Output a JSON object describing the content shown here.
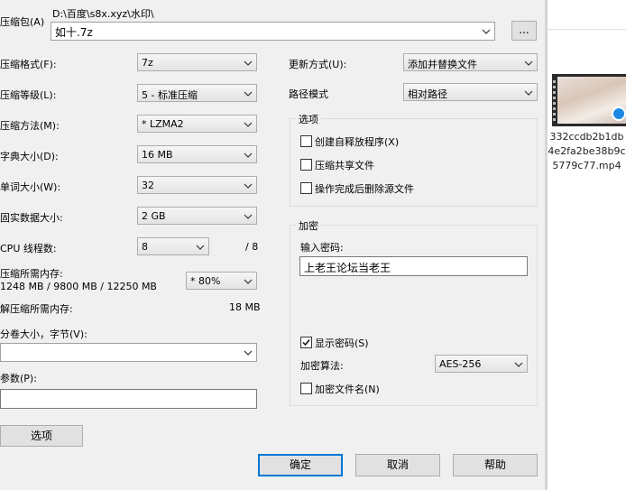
{
  "archive": {
    "label": "压缩包(A)",
    "path": "D:\\百度\\s8x.xyz\\水印\\",
    "filename": "如十.7z",
    "browse_label": "..."
  },
  "left": {
    "format": {
      "label": "压缩格式(F):",
      "value": "7z"
    },
    "level": {
      "label": "压缩等级(L):",
      "value": "5 - 标准压缩"
    },
    "method": {
      "label": "压缩方法(M):",
      "value": "* LZMA2"
    },
    "dict": {
      "label": "字典大小(D):",
      "value": "16 MB"
    },
    "word": {
      "label": "单词大小(W):",
      "value": "32"
    },
    "solid": {
      "label": "固实数据大小:",
      "value": "2 GB"
    },
    "threads": {
      "label": "CPU 线程数:",
      "value": "8",
      "total": "/ 8"
    },
    "mem_compress": {
      "label": "压缩所需内存:",
      "values": "1248 MB / 9800 MB / 12250 MB",
      "percent": "* 80%"
    },
    "mem_decompress": {
      "label": "解压缩所需内存:",
      "value": "18 MB"
    },
    "volume": {
      "label": "分卷大小，字节(V):",
      "value": ""
    },
    "params": {
      "label": "参数(P):",
      "value": ""
    },
    "options_button": "选项"
  },
  "right": {
    "update": {
      "label": "更新方式(U):",
      "value": "添加并替换文件"
    },
    "path_mode": {
      "label": "路径模式",
      "value": "相对路径"
    },
    "options_group": {
      "title": "选项",
      "sfx": {
        "label": "创建自释放程序(X)",
        "checked": false
      },
      "shared": {
        "label": "压缩共享文件",
        "checked": false
      },
      "delete": {
        "label": "操作完成后删除源文件",
        "checked": false
      }
    },
    "encryption": {
      "title": "加密",
      "password_label": "输入密码:",
      "password_value": "上老王论坛当老王",
      "show_password": {
        "label": "显示密码(S)",
        "checked": true
      },
      "method_label": "加密算法:",
      "method_value": "AES-256",
      "encrypt_names": {
        "label": "加密文件名(N)",
        "checked": false
      }
    }
  },
  "buttons": {
    "ok": "确定",
    "cancel": "取消",
    "help": "帮助"
  },
  "background_file": {
    "name_lines": [
      "332ccdb2b1db",
      "4e2fa2be38b9c",
      "5779c77.mp4"
    ]
  },
  "colors": {
    "accent": "#0078d7",
    "dialog_bg": "#f0f0f0"
  }
}
